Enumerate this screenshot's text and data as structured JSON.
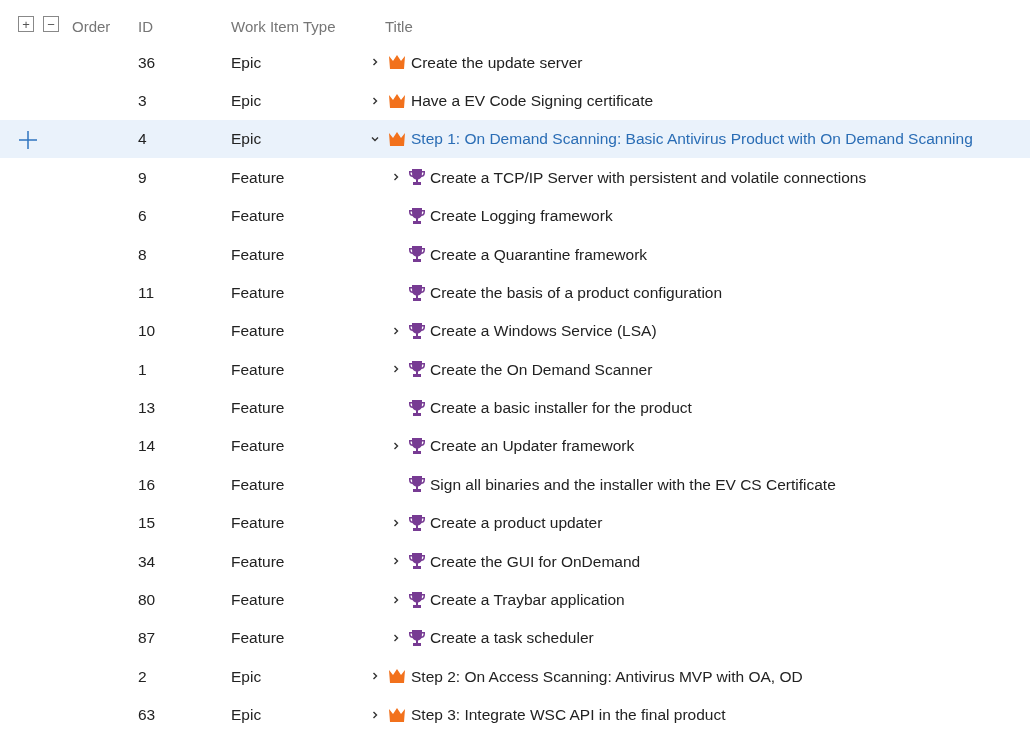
{
  "toolbar": {
    "expand_all": "+",
    "collapse_all": "−"
  },
  "columns": [
    "Order",
    "ID",
    "Work Item Type",
    "Title"
  ],
  "rows": [
    {
      "id": "36",
      "type": "Epic",
      "kind": "epic",
      "title": "Create the update server",
      "expanded": false,
      "selected": false
    },
    {
      "id": "3",
      "type": "Epic",
      "kind": "epic",
      "title": "Have a EV Code Signing certificate",
      "expanded": false,
      "selected": false
    },
    {
      "id": "4",
      "type": "Epic",
      "kind": "epic",
      "title": "Step 1: On Demand Scanning: Basic Antivirus Product with On Demand Scanning",
      "expanded": true,
      "selected": true,
      "children": [
        {
          "id": "9",
          "type": "Feature",
          "kind": "feature",
          "title": "Create a TCP/IP Server with persistent and volatile connections",
          "expanded": false,
          "selected": false
        },
        {
          "id": "6",
          "type": "Feature",
          "kind": "feature",
          "title": "Create Logging framework",
          "selected": false
        },
        {
          "id": "8",
          "type": "Feature",
          "kind": "feature",
          "title": "Create a Quarantine framework",
          "selected": false
        },
        {
          "id": "11",
          "type": "Feature",
          "kind": "feature",
          "title": "Create the basis of a product configuration",
          "selected": false
        },
        {
          "id": "10",
          "type": "Feature",
          "kind": "feature",
          "title": "Create a Windows Service (LSA)",
          "expanded": false,
          "selected": false
        },
        {
          "id": "1",
          "type": "Feature",
          "kind": "feature",
          "title": "Create the On Demand Scanner",
          "expanded": false,
          "selected": false
        },
        {
          "id": "13",
          "type": "Feature",
          "kind": "feature",
          "title": "Create a basic installer for the product",
          "selected": false
        },
        {
          "id": "14",
          "type": "Feature",
          "kind": "feature",
          "title": "Create an Updater framework",
          "expanded": false,
          "selected": false
        },
        {
          "id": "16",
          "type": "Feature",
          "kind": "feature",
          "title": "Sign all binaries and the installer with the EV CS Certificate",
          "selected": false
        },
        {
          "id": "15",
          "type": "Feature",
          "kind": "feature",
          "title": "Create a product updater",
          "expanded": false,
          "selected": false
        },
        {
          "id": "34",
          "type": "Feature",
          "kind": "feature",
          "title": "Create the GUI for OnDemand",
          "expanded": false,
          "selected": false
        },
        {
          "id": "80",
          "type": "Feature",
          "kind": "feature",
          "title": "Create a Traybar application",
          "expanded": false,
          "selected": false
        },
        {
          "id": "87",
          "type": "Feature",
          "kind": "feature",
          "title": "Create a task scheduler",
          "expanded": false,
          "selected": false
        }
      ]
    },
    {
      "id": "2",
      "type": "Epic",
      "kind": "epic",
      "title": "Step 2: On Access Scanning: Antivirus MVP with OA, OD",
      "expanded": false,
      "selected": false
    },
    {
      "id": "63",
      "type": "Epic",
      "kind": "epic",
      "title": "Step 3: Integrate WSC API in the final product",
      "expanded": false,
      "selected": false
    }
  ]
}
